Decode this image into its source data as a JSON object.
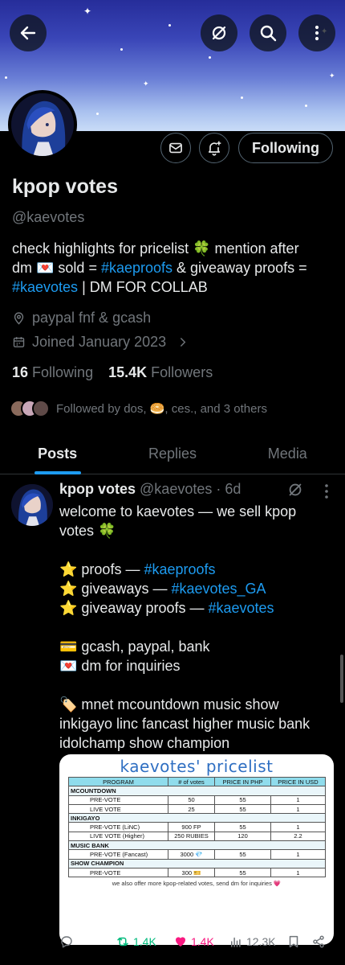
{
  "profile": {
    "name": "kpop votes",
    "handle": "@kaevotes",
    "follow_label": "Following",
    "bio": {
      "line1_a": "check highlights for pricelist 🍀 mention after",
      "line2_a": "dm 💌 sold = ",
      "link1": "#kaeproofs",
      "line2_b": " & giveaway proofs =",
      "link2": "#kaevotes",
      "line3_b": " | DM FOR COLLAB"
    },
    "location": "paypal fnf & gcash",
    "joined": "Joined January 2023",
    "following_count": "16",
    "following_label": "Following",
    "followers_count": "15.4K",
    "followers_label": "Followers",
    "followed_by": "Followed by dos, 🥯, ces., and 3 others"
  },
  "tabs": [
    "Posts",
    "Replies",
    "Media"
  ],
  "post": {
    "author": "kpop votes",
    "handle": "@kaevotes",
    "time": "· 6d",
    "text": {
      "l1": "welcome to kaevotes — we sell kpop",
      "l2": "votes 🍀",
      "proofs_a": "⭐ proofs — ",
      "proofs_link": "#kaeproofs",
      "ga_a": "⭐ giveaways — ",
      "ga_link": "#kaevotes_GA",
      "gp_a": "⭐ giveaway proofs — ",
      "gp_link": "#kaevotes",
      "pay": "💳 gcash, paypal, bank",
      "dm": "💌 dm for inquiries",
      "s1": "🏷️ mnet mcountdown music show",
      "s2": "inkigayo linc fancast higher music bank",
      "s3": "idolchamp show champion"
    },
    "pricelist": {
      "title": "kaevotes' pricelist",
      "headers": [
        "PROGRAM",
        "# of votes",
        "PRICE IN PHP",
        "PRICE IN USD"
      ],
      "sections": [
        {
          "name": "MCOUNTDOWN",
          "rows": [
            [
              "PRE-VOTE",
              "50",
              "55",
              "1"
            ],
            [
              "LIVE VOTE",
              "25",
              "55",
              "1"
            ]
          ]
        },
        {
          "name": "INKIGAYO",
          "rows": [
            [
              "PRE-VOTE (LiNC)",
              "900 FP",
              "55",
              "1"
            ],
            [
              "LIVE VOTE (Higher)",
              "250 RUBIES",
              "120",
              "2.2"
            ]
          ]
        },
        {
          "name": "MUSIC BANK",
          "rows": [
            [
              "PRE-VOTE (Fancast)",
              "3000 💎",
              "55",
              "1"
            ]
          ]
        },
        {
          "name": "SHOW CHAMPION",
          "rows": [
            [
              "PRE-VOTE",
              "300 🎫",
              "55",
              "1"
            ]
          ]
        }
      ],
      "note": "we also offer more kpop-related votes, send dm for inquiries 💗"
    },
    "stats": {
      "retweets": "1.4K",
      "likes": "1.4K",
      "views": "12.3K"
    }
  },
  "colors": {
    "accent": "#1d9bf0",
    "like": "#f91880",
    "retweet": "#00ba7c",
    "muted": "#71767b"
  }
}
